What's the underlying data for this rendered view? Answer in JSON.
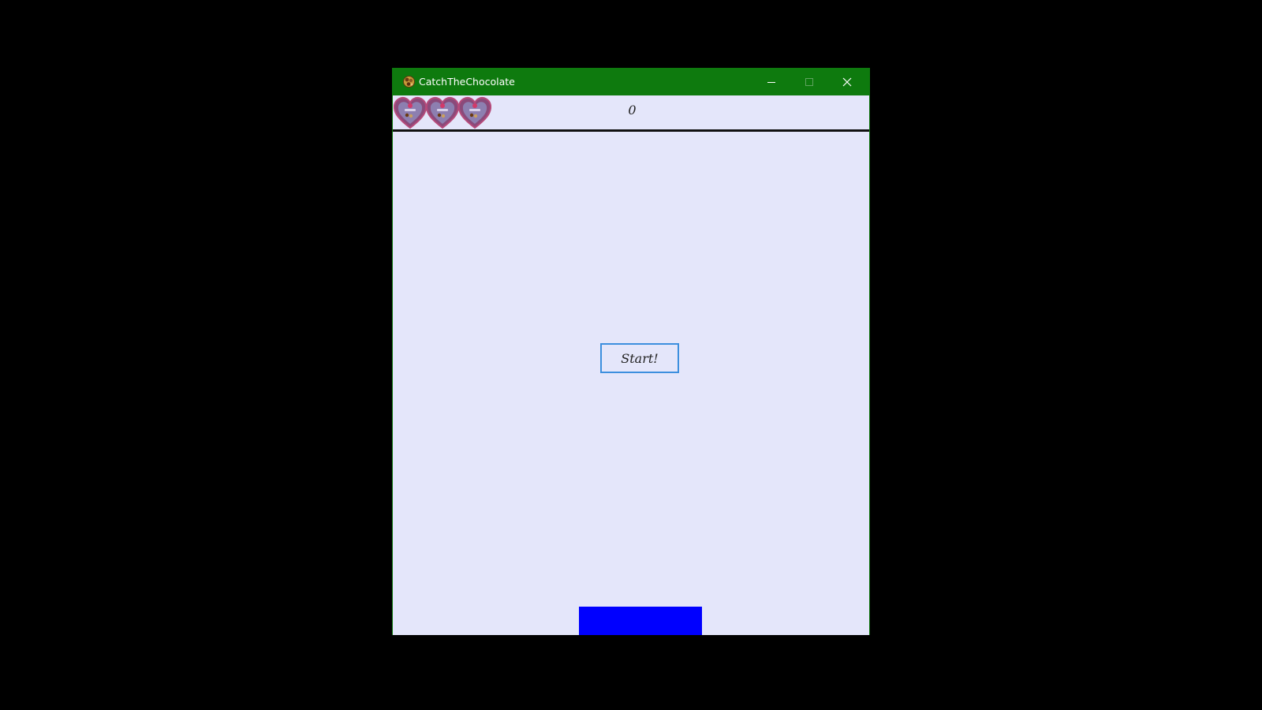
{
  "window": {
    "title": "CatchTheChocolate",
    "controls": {
      "minimize_icon": "minimize-icon",
      "maximize_icon": "maximize-icon",
      "close_icon": "close-icon"
    },
    "title_bar_color": "#0e7a0e"
  },
  "hud": {
    "lives": 3,
    "life_icon": "heart-chocolate-box-icon",
    "score": "0"
  },
  "game": {
    "background_color": "#e4e6fa",
    "start_label": "Start!",
    "paddle_color": "#0000ff"
  }
}
